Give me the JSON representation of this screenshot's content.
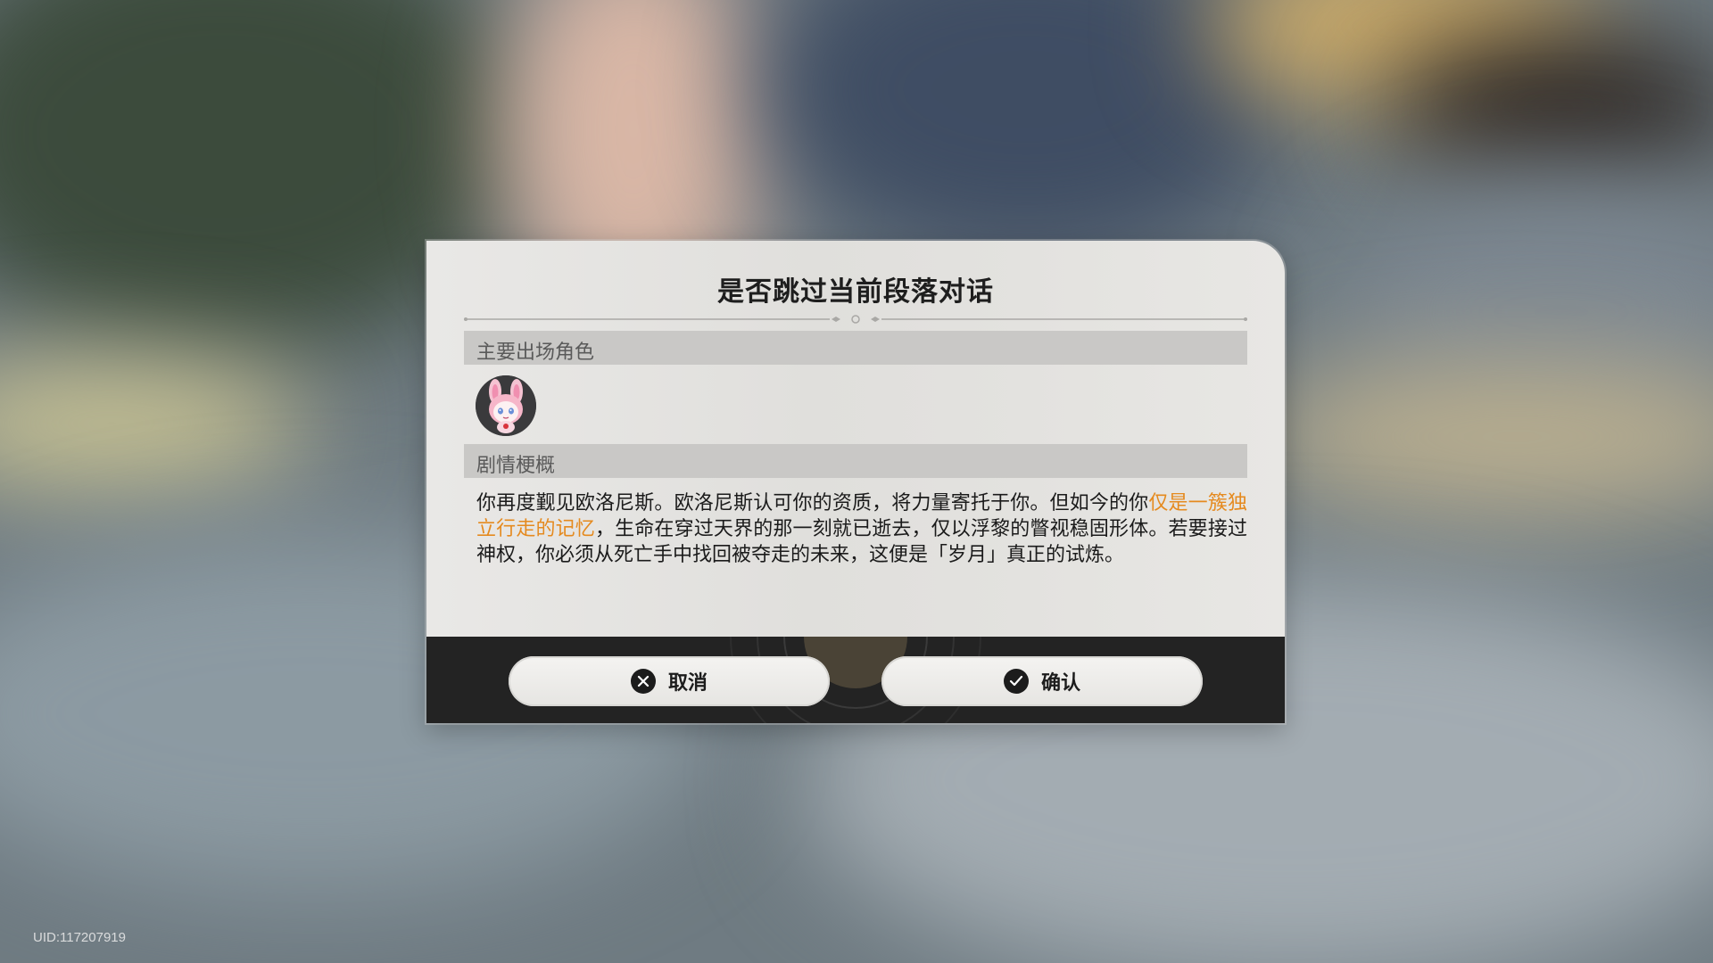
{
  "dialog": {
    "title": "是否跳过当前段落对话",
    "characters_section_label": "主要出场角色",
    "characters": [
      {
        "icon": "pink-rabbit-character-avatar"
      }
    ],
    "synopsis_section_label": "剧情梗概",
    "synopsis": {
      "before": "你再度觐见欧洛尼斯。欧洛尼斯认可你的资质，将力量寄托于你。但如今的你",
      "highlight": "仅是一簇独立行走的记忆",
      "after": "，生命在穿过天界的那一刻就已逝去，仅以浮黎的瞥视稳固形体。若要接过神权，你必须从死亡手中找回被夺走的未来，这便是「岁月」真正的试炼。"
    },
    "buttons": {
      "cancel_label": "取消",
      "cancel_icon": "close-circle-icon",
      "confirm_label": "确认",
      "confirm_icon": "check-circle-icon"
    }
  },
  "uid": "UID:117207919",
  "colors": {
    "highlight": "#e58a1f",
    "footer": "#232323",
    "section_bar": "#c9c8c6"
  }
}
